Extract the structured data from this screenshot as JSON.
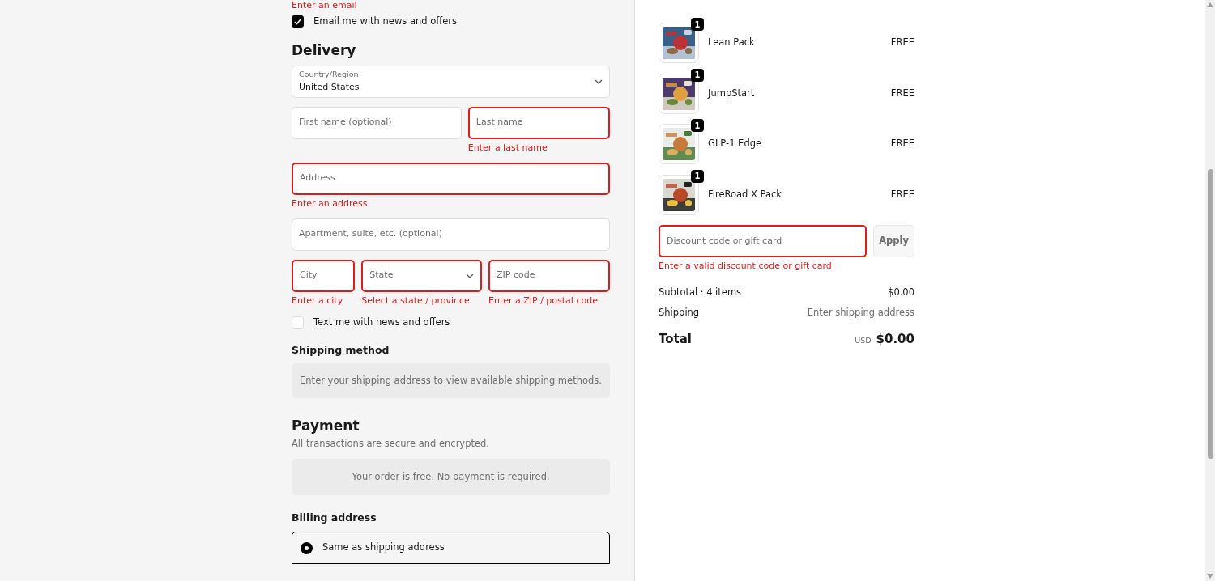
{
  "contact": {
    "error": "Enter an email",
    "email_news": {
      "label": "Email me with news and offers",
      "checked": true
    }
  },
  "delivery": {
    "title": "Delivery",
    "country": {
      "kind": "select",
      "label": "Country/Region",
      "value": "United States",
      "invalid": false
    },
    "name_fields": [
      {
        "kind": "input",
        "placeholder": "First name (optional)",
        "invalid": false
      },
      {
        "kind": "input",
        "placeholder": "Last name",
        "invalid": true,
        "error": "Enter a last name"
      }
    ],
    "address": {
      "kind": "input",
      "placeholder": "Address",
      "invalid": true,
      "error": "Enter an address"
    },
    "apartment": {
      "kind": "input",
      "placeholder": "Apartment, suite, etc. (optional)",
      "invalid": false
    },
    "locality_fields": [
      {
        "kind": "input",
        "placeholder": "City",
        "invalid": true,
        "error": "Enter a city"
      },
      {
        "kind": "select",
        "placeholder": "State",
        "invalid": true,
        "error": "Select a state / province"
      },
      {
        "kind": "input",
        "placeholder": "ZIP code",
        "invalid": true,
        "error": "Enter a ZIP / postal code"
      }
    ],
    "sms_news": {
      "label": "Text me with news and offers",
      "checked": false
    }
  },
  "shipping_method": {
    "title": "Shipping method",
    "notice": "Enter your shipping address to view available shipping methods."
  },
  "payment": {
    "title": "Payment",
    "subtitle": "All transactions are secure and encrypted.",
    "notice": "Your order is free. No payment is required."
  },
  "billing": {
    "title": "Billing address",
    "options": [
      {
        "label": "Same as shipping address",
        "selected": true
      }
    ]
  },
  "order": {
    "items": [
      {
        "name": "Lean Pack",
        "quantity": "1",
        "price": "FREE"
      },
      {
        "name": "JumpStart",
        "quantity": "1",
        "price": "FREE"
      },
      {
        "name": "GLP-1 Edge",
        "quantity": "1",
        "price": "FREE"
      },
      {
        "name": "FireRoad X Pack",
        "quantity": "1",
        "price": "FREE"
      }
    ],
    "discount": {
      "placeholder": "Discount code or gift card",
      "invalid": true,
      "error": "Enter a valid discount code or gift card",
      "button": "Apply"
    },
    "summary": [
      {
        "label": "Subtotal · 4 items",
        "value": "$0.00",
        "muted": false
      },
      {
        "label": "Shipping",
        "value": "Enter shipping address",
        "muted": true
      }
    ],
    "total": {
      "label": "Total",
      "currency": "USD",
      "value": "$0.00"
    }
  }
}
